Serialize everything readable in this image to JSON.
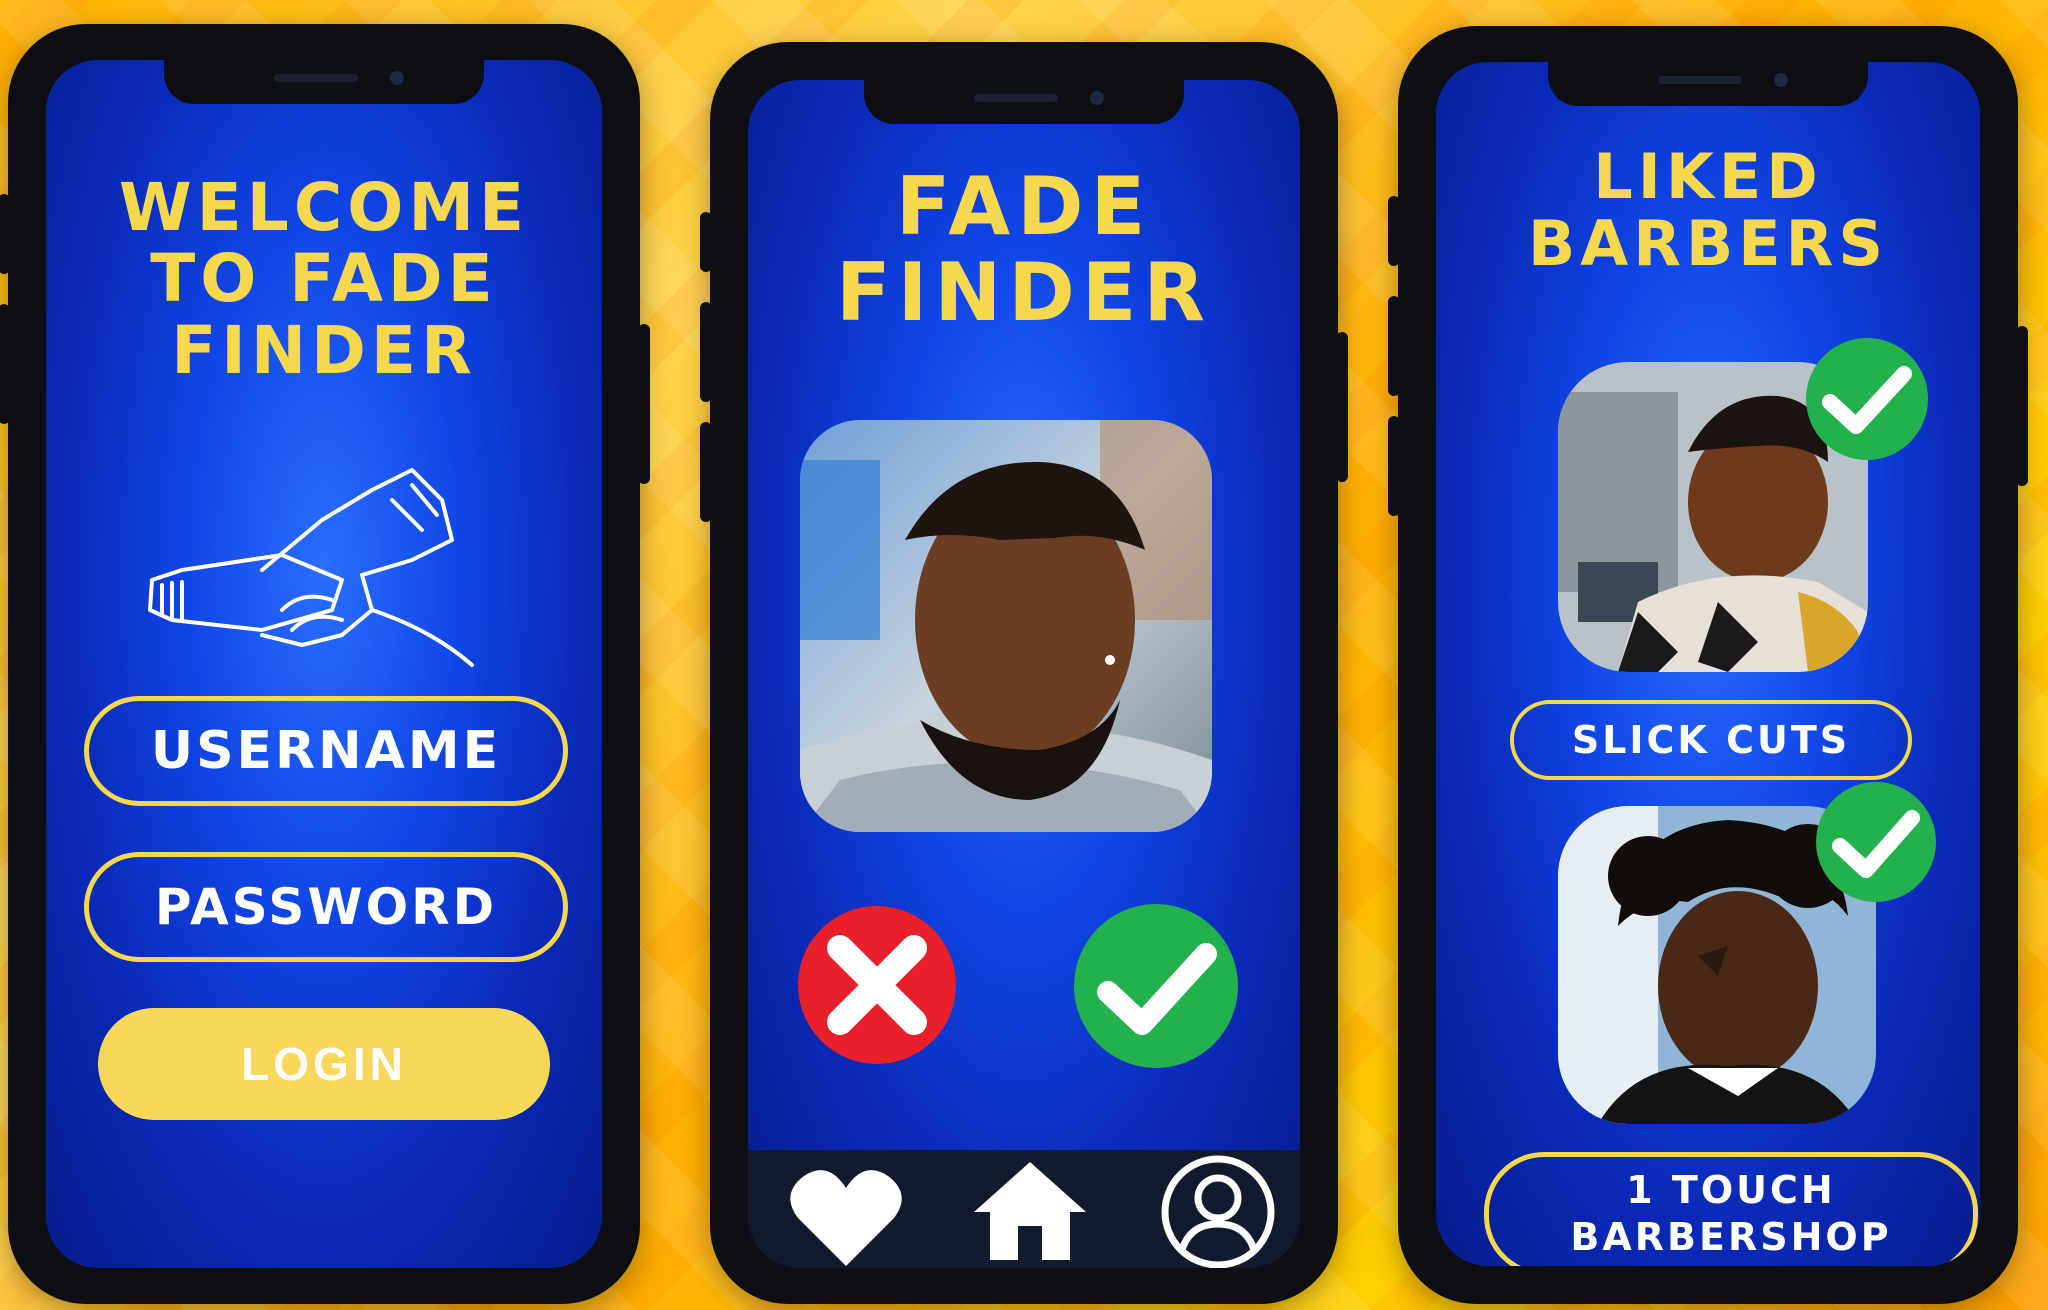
{
  "screens": {
    "login": {
      "title_lines": [
        "WELCOME",
        "TO  FADE",
        "FINDER"
      ],
      "username_label": "USERNAME",
      "password_label": "PASSWORD",
      "login_label": "LOGIN",
      "logo_icon": "clipper-hand-icon"
    },
    "swipe": {
      "title_lines": [
        "FADE",
        "FINDER"
      ],
      "photo": "barber-photo-wave-fade",
      "reject_icon": "x-icon",
      "like_icon": "check-icon",
      "nav": {
        "favorites_icon": "heart-icon",
        "home_icon": "home-icon",
        "profile_icon": "user-icon"
      }
    },
    "liked": {
      "title_lines": [
        "LIKED",
        "BARBERS"
      ],
      "barbers": [
        {
          "name": "SLICK CUTS",
          "photo": "barber-photo-taper-fade"
        },
        {
          "name": "1  TOUCH BARBERSHOP",
          "name_lines": [
            "1  TOUCH",
            "BARBERSHOP"
          ],
          "photo": "barber-photo-curly-design"
        }
      ]
    }
  },
  "colors": {
    "accent_yellow": "#f6d84e",
    "screen_blue": "#1046e6",
    "like_green": "#22b14c",
    "reject_red": "#e8202a",
    "nav_dark": "#121a2e"
  }
}
